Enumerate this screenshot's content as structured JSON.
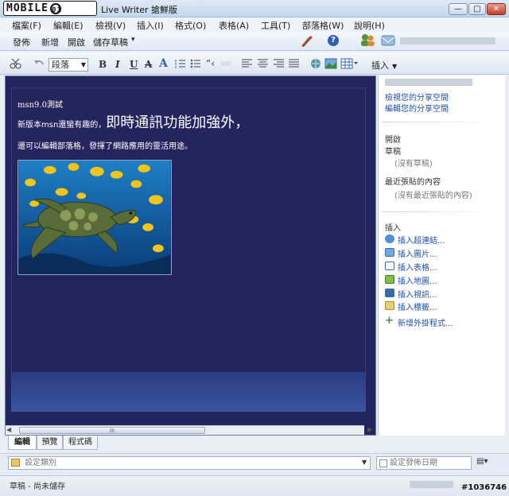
{
  "titlebar": {
    "logo_text": "MOBILE",
    "logo_e": "01",
    "title": "Live Writer 搶鮮版",
    "min": "—",
    "max": "□",
    "close": "✕"
  },
  "menu": [
    "檔案(F)",
    "編輯(E)",
    "檢視(V)",
    "插入(I)",
    "格式(O)",
    "表格(A)",
    "工具(T)",
    "部落格(W)",
    "說明(H)"
  ],
  "toolbar1": {
    "publish": "發佈",
    "new": "新增",
    "open": "開啟",
    "save_draft": "儲存草稿",
    "dropdown_arrow": "▾",
    "help": "?"
  },
  "toolbar2": {
    "style_value": "段落",
    "bold": "B",
    "italic": "I",
    "underline": "U",
    "strike": "A",
    "font_color": "A",
    "insert_label": "插入"
  },
  "editor": {
    "post_title": "msn9.0測試",
    "line1_start": "新版本msn還蠻有趣的，",
    "line1_big": "即時通訊功能加強外，",
    "line2": "還可以編輯部落格，發揮了網路應用的靈活用途。",
    "scroll_grip": "III"
  },
  "sidebar": {
    "view_space": "檢視您的分享空間",
    "edit_space": "編輯您的分享空間",
    "open_heading": "開啟",
    "drafts_heading": "草稿",
    "no_drafts": "(沒有草稿)",
    "recent_heading": "最近張貼的內容",
    "no_recent": "(沒有最近張貼的內容)",
    "insert_heading": "插入",
    "insert_items": [
      "插入超連結...",
      "插入圖片...",
      "插入表格...",
      "插入地圖...",
      "插入視訊...",
      "插入標籤..."
    ],
    "add_plugin": "新增外掛程式..."
  },
  "tabs": [
    "編輯",
    "預覽",
    "程式碼"
  ],
  "categories": {
    "placeholder": "設定類別",
    "date_placeholder": "設定發佈日期"
  },
  "status": {
    "text": "草稿 - 尚未儲存",
    "watermark": "#1036746"
  },
  "colors": {
    "editor_bg": "#24245e",
    "link": "#1d4f9c"
  },
  "icons": [
    "cut-icon",
    "undo-icon",
    "align-left-icon",
    "align-center-icon",
    "align-right-icon",
    "justify-icon",
    "numbered-list-icon",
    "bullet-list-icon",
    "quote-icon",
    "link-icon",
    "image-icon",
    "table-icon",
    "spellcheck-brush-icon",
    "help-icon",
    "contacts-icon",
    "mail-icon"
  ]
}
